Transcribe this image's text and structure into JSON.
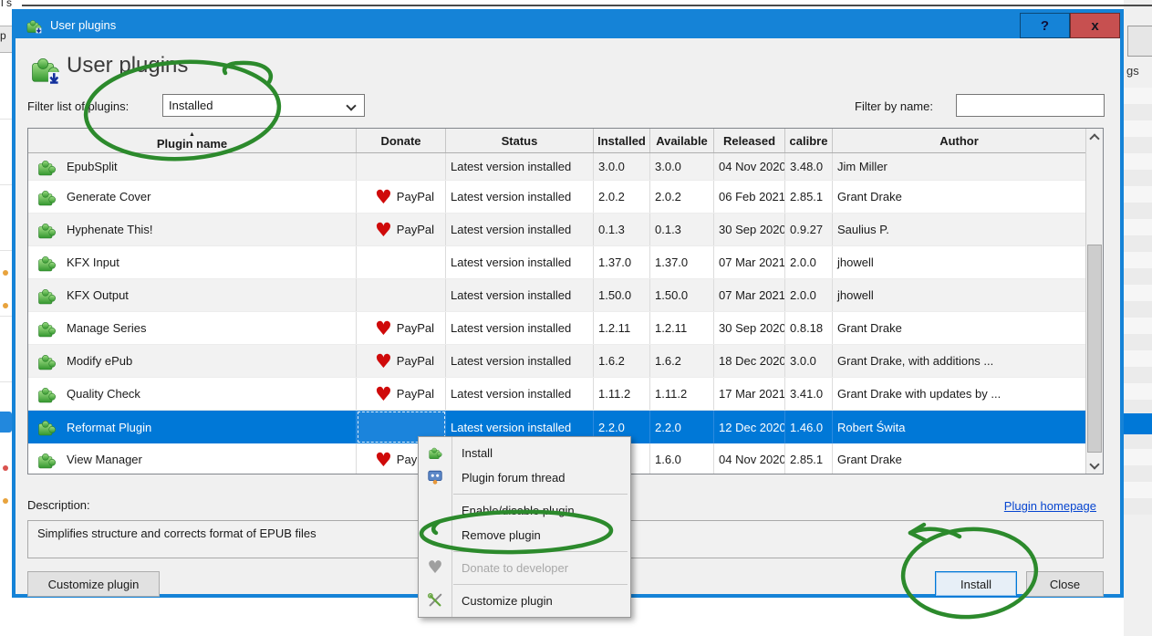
{
  "background": {
    "top_left_text": "l s",
    "left_label": "p",
    "right_text": "gs"
  },
  "dialog": {
    "title_bar": {
      "title": "User plugins",
      "help_label": "?",
      "close_label": "x"
    },
    "heading": "User plugins",
    "filter_list_label": "Filter list of plugins:",
    "filter_list_value": "Installed",
    "filter_name_label": "Filter by name:",
    "filter_name_value": "",
    "table": {
      "columns": [
        "Plugin name",
        "Donate",
        "Status",
        "Installed",
        "Available",
        "Released",
        "calibre",
        "Author"
      ],
      "sort_column": "Plugin name",
      "sort_indicator": "▲",
      "rows": [
        {
          "name": "EpubSplit",
          "donate": "",
          "status": "Latest version installed",
          "installed": "3.0.0",
          "available": "3.0.0",
          "released": "04 Nov 2020",
          "calibre": "3.48.0",
          "author": "Jim Miller"
        },
        {
          "name": "Generate Cover",
          "donate": "PayPal",
          "status": "Latest version installed",
          "installed": "2.0.2",
          "available": "2.0.2",
          "released": "06 Feb 2021",
          "calibre": "2.85.1",
          "author": "Grant Drake"
        },
        {
          "name": "Hyphenate This!",
          "donate": "PayPal",
          "status": "Latest version installed",
          "installed": "0.1.3",
          "available": "0.1.3",
          "released": "30 Sep 2020",
          "calibre": "0.9.27",
          "author": "Saulius P."
        },
        {
          "name": "KFX Input",
          "donate": "",
          "status": "Latest version installed",
          "installed": "1.37.0",
          "available": "1.37.0",
          "released": "07 Mar 2021",
          "calibre": "2.0.0",
          "author": "jhowell"
        },
        {
          "name": "KFX Output",
          "donate": "",
          "status": "Latest version installed",
          "installed": "1.50.0",
          "available": "1.50.0",
          "released": "07 Mar 2021",
          "calibre": "2.0.0",
          "author": "jhowell"
        },
        {
          "name": "Manage Series",
          "donate": "PayPal",
          "status": "Latest version installed",
          "installed": "1.2.11",
          "available": "1.2.11",
          "released": "30 Sep 2020",
          "calibre": "0.8.18",
          "author": "Grant Drake"
        },
        {
          "name": "Modify ePub",
          "donate": "PayPal",
          "status": "Latest version installed",
          "installed": "1.6.2",
          "available": "1.6.2",
          "released": "18 Dec 2020",
          "calibre": "3.0.0",
          "author": "Grant Drake, with additions ..."
        },
        {
          "name": "Quality Check",
          "donate": "PayPal",
          "status": "Latest version installed",
          "installed": "1.11.2",
          "available": "1.11.2",
          "released": "17 Mar 2021",
          "calibre": "3.41.0",
          "author": "Grant Drake with updates by ..."
        },
        {
          "name": "Reformat Plugin",
          "donate": "",
          "status": "Latest version installed",
          "installed": "2.2.0",
          "available": "2.2.0",
          "released": "12 Dec 2020",
          "calibre": "1.46.0",
          "author": "Robert Świta",
          "selected": true
        },
        {
          "name": "View Manager",
          "donate": "PayPal",
          "status": "",
          "installed": "",
          "available": "1.6.0",
          "released": "04 Nov 2020",
          "calibre": "2.85.1",
          "author": "Grant Drake"
        }
      ]
    },
    "description_label": "Description:",
    "description_text": "Simplifies structure and corrects format of EPUB files",
    "homepage_link": "Plugin homepage",
    "buttons": {
      "customize": "Customize plugin",
      "install": "Install",
      "close": "Close"
    }
  },
  "context_menu": {
    "items": [
      {
        "label": "Install",
        "icon": "plugin-puzzle-icon"
      },
      {
        "label": "Plugin forum thread",
        "icon": "forum-icon"
      },
      {
        "separator": true
      },
      {
        "label": "Enable/disable plugin"
      },
      {
        "label": "Remove plugin"
      },
      {
        "separator": true
      },
      {
        "label": "Donate to developer",
        "icon": "heart-gray-icon",
        "disabled": true
      },
      {
        "separator": true
      },
      {
        "label": "Customize plugin",
        "icon": "tools-icon"
      }
    ]
  },
  "icons": {
    "heart_glyph": "♥"
  },
  "colors": {
    "titlebar_blue": "#1583d7",
    "selection_blue": "#0078d7",
    "close_red": "#c75050",
    "annotation_green": "#2c8a2c",
    "link_blue": "#0645d0",
    "heart_red": "#cf0a0a"
  },
  "annotations": [
    "circle-around-installed-filter",
    "circle-around-remove-plugin",
    "circle-around-install-button"
  ]
}
